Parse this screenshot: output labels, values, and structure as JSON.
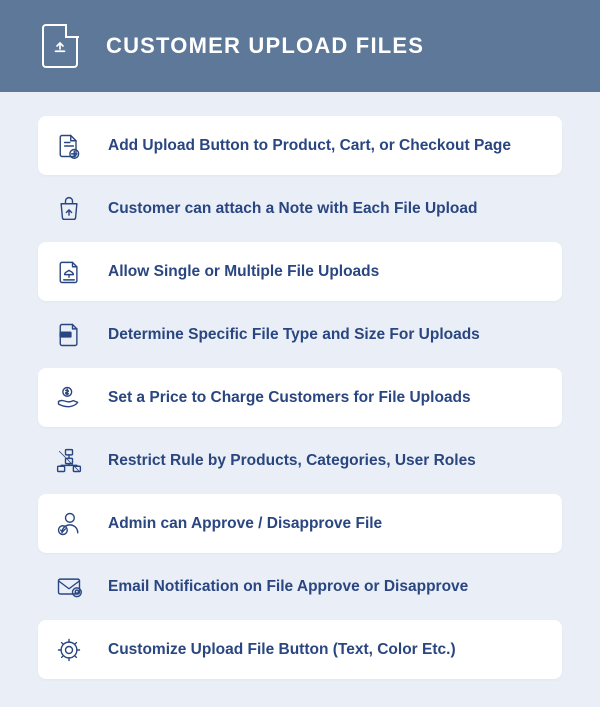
{
  "header": {
    "title": "CUSTOMER UPLOAD FILES"
  },
  "features": {
    "items": [
      {
        "label": "Add Upload Button to Product, Cart, or Checkout Page",
        "icon": "file-add-icon"
      },
      {
        "label": "Customer can attach a Note with Each File Upload",
        "icon": "bag-upload-icon"
      },
      {
        "label": "Allow Single or Multiple File Uploads",
        "icon": "file-multi-upload-icon"
      },
      {
        "label": "Determine Specific File Type and Size For Uploads",
        "icon": "file-type-icon"
      },
      {
        "label": "Set a Price to Charge Customers for File Uploads",
        "icon": "hand-money-icon"
      },
      {
        "label": "Restrict Rule by Products, Categories, User Roles",
        "icon": "hierarchy-icon"
      },
      {
        "label": "Admin can Approve / Disapprove File",
        "icon": "user-check-icon"
      },
      {
        "label": "Email Notification on File Approve or Disapprove",
        "icon": "mail-notify-icon"
      },
      {
        "label": "Customize Upload File Button (Text, Color Etc.)",
        "icon": "gear-icon"
      }
    ]
  }
}
